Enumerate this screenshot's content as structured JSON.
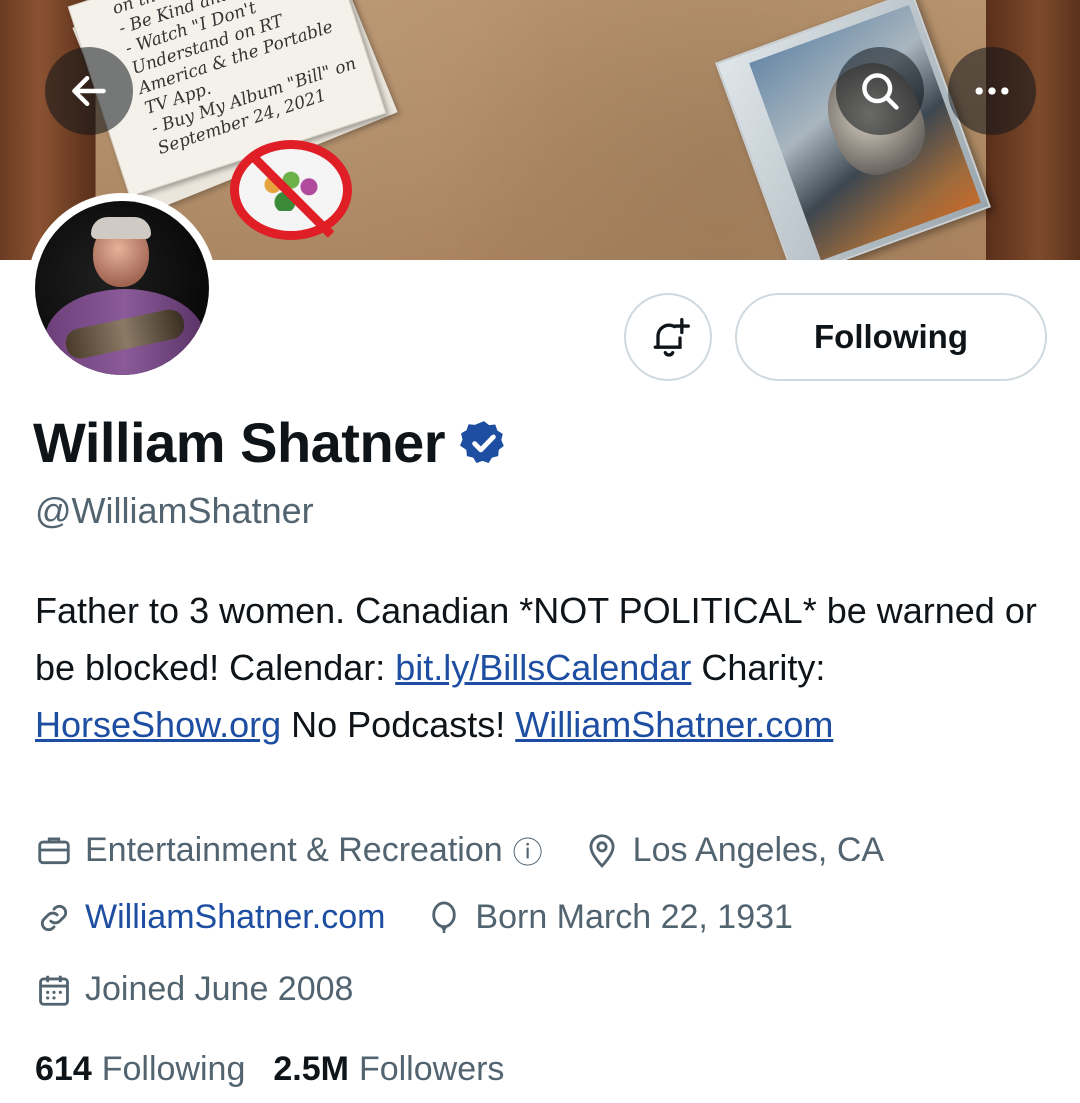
{
  "banner": {
    "note_lines": [
      "on the",
      "- Be Kind and",
      "- Watch \"I Don't",
      "Understand on RT",
      "America & the Portable",
      "TV App.",
      "- Buy My Album \"Bill\" on",
      "September 24, 2021"
    ],
    "album_label": "Bill"
  },
  "nav": {
    "back_icon": "arrow-left",
    "search_icon": "search",
    "more_icon": "ellipsis"
  },
  "profile": {
    "name": "William Shatner",
    "handle": "@WilliamShatner",
    "verified": true,
    "accent": "#1d4ea1"
  },
  "actions": {
    "notify_icon": "bell-plus",
    "follow_label": "Following"
  },
  "bio": {
    "text1": "Father to 3 women. Canadian *NOT POLITICAL* be warned or be blocked! Calendar: ",
    "link1": "bit.ly/BillsCalendar",
    "text2": " Charity: ",
    "link2": "HorseShow.org",
    "text3": " No Podcasts! ",
    "link3": "WilliamShatner.com"
  },
  "meta": {
    "category": "Entertainment & Recreation",
    "info_glyph": "ⓘ",
    "location": "Los Angeles, CA",
    "website": "WilliamShatner.com",
    "birthday": "Born March 22, 1931",
    "joined": "Joined June 2008"
  },
  "stats": {
    "following_count": "614",
    "following_label": "Following",
    "followers_count": "2.5M",
    "followers_label": "Followers"
  }
}
